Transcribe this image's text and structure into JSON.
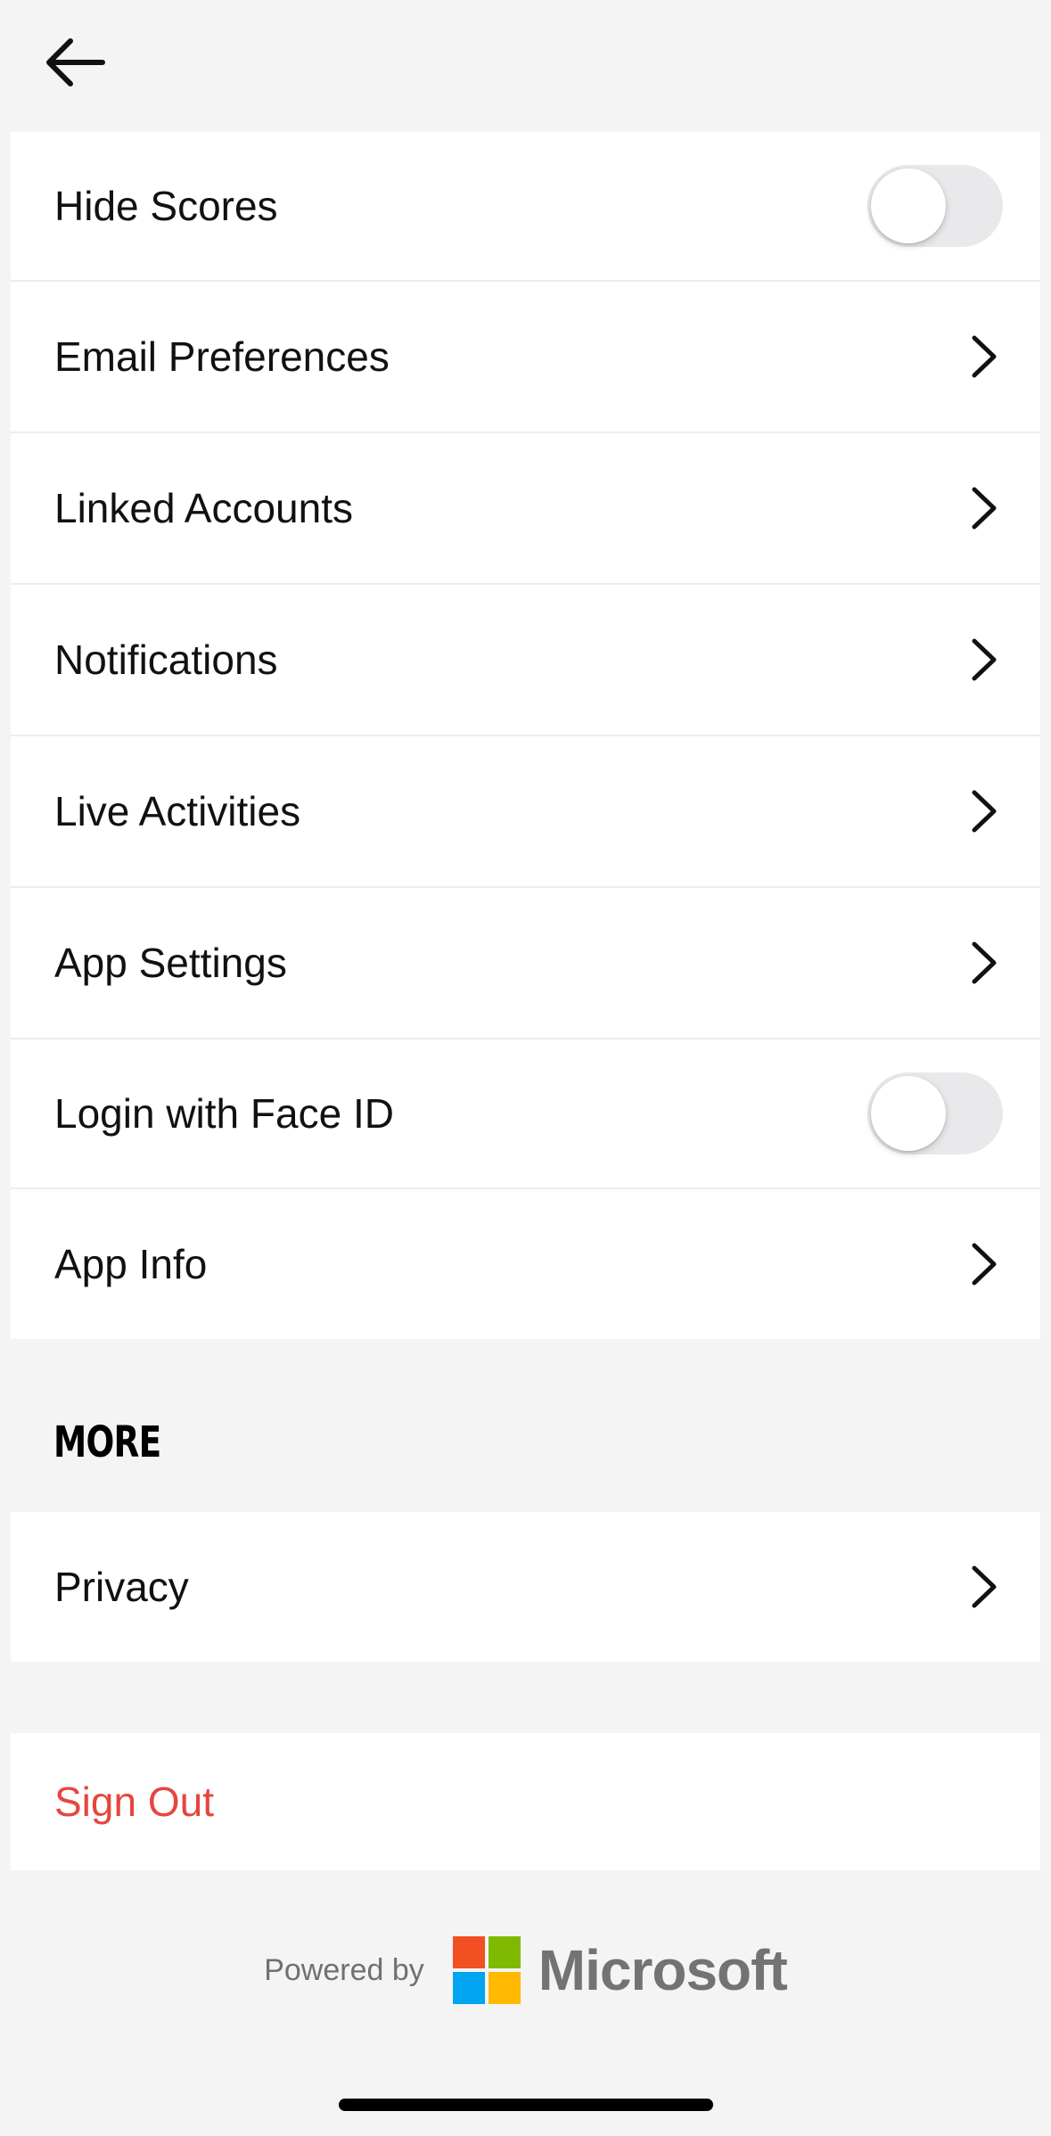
{
  "header": {
    "back_icon": "arrow-left-icon"
  },
  "settings": {
    "items": [
      {
        "label": "Hide Scores",
        "control": "toggle",
        "on": false
      },
      {
        "label": "Email Preferences",
        "control": "chevron"
      },
      {
        "label": "Linked Accounts",
        "control": "chevron"
      },
      {
        "label": "Notifications",
        "control": "chevron"
      },
      {
        "label": "Live Activities",
        "control": "chevron"
      },
      {
        "label": "App Settings",
        "control": "chevron"
      },
      {
        "label": "Login with Face ID",
        "control": "toggle",
        "on": false
      },
      {
        "label": "App Info",
        "control": "chevron"
      }
    ]
  },
  "more": {
    "title": "MORE",
    "items": [
      {
        "label": "Privacy",
        "control": "chevron"
      }
    ]
  },
  "signout": {
    "label": "Sign Out",
    "color": "#e5463e"
  },
  "footer": {
    "powered_by": "Powered by",
    "brand": "Microsoft",
    "logo_colors": [
      "#f25022",
      "#7fba00",
      "#00a4ef",
      "#ffb900"
    ]
  }
}
